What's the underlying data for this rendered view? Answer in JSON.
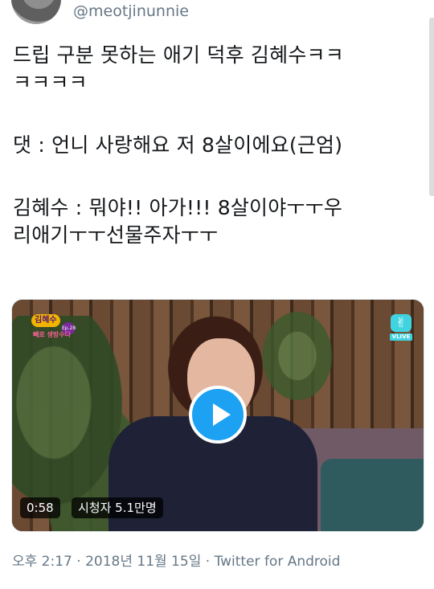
{
  "user": {
    "handle": "@meotjinunnie"
  },
  "tweet": {
    "lines": [
      "드립 구분 못하는 애기 덕후 김혜수ㅋㅋ",
      "ㅋㅋㅋㅋ",
      "댓 : 언니 사랑해요 저 8살이에요(근엄)",
      "김혜수 : 뭐야!! 아가!!!    8살이야ㅜㅜ우",
      "리애기ㅜㅜ선물주자ㅜㅜ"
    ]
  },
  "media": {
    "duration": "0:58",
    "views": "시청자 5.1만명",
    "show_logo_title": "김혜수",
    "show_logo_episode": "Ep.28",
    "show_logo_sub": "빼로 생방수다",
    "vlive_label": "VLIVE"
  },
  "meta": {
    "time": "오후 2:17",
    "separator": " · ",
    "date": "2018년 11월 15일",
    "source": "Twitter for Android"
  },
  "colors": {
    "accent": "#1da1f2",
    "secondary_text": "#657786",
    "primary_text": "#14171a"
  }
}
